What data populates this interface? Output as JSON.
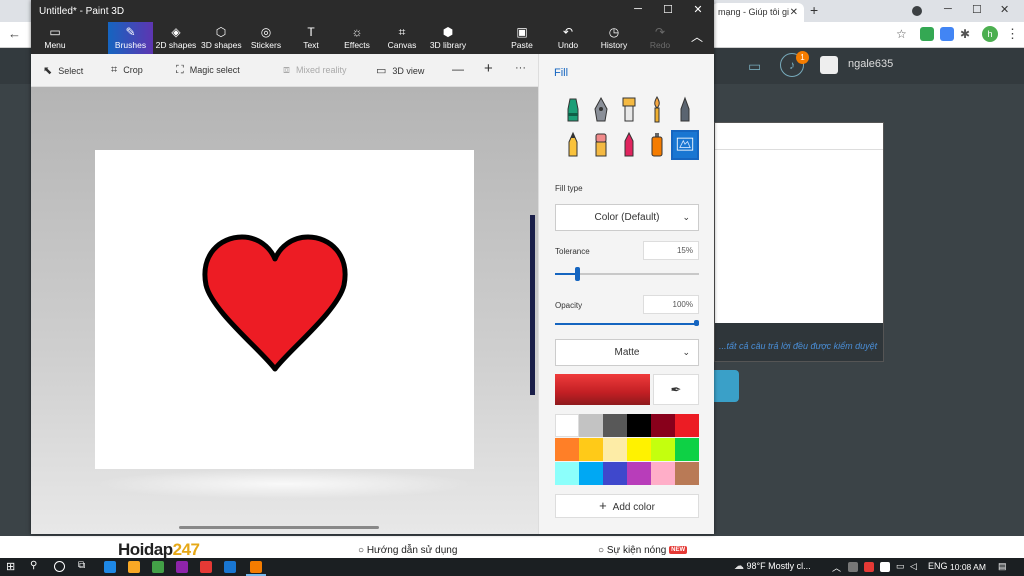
{
  "browser": {
    "tab_title": "mạng - Giúp tôi gi",
    "tab_close": "✕",
    "new_tab": "+",
    "min": "─",
    "max": "☐",
    "close": "✕",
    "avatar_letter": "h",
    "back": "←"
  },
  "site": {
    "user_name": "ngale635",
    "notification_count": "1",
    "note": "...tất cả câu trả lời đều được kiểm duyệt",
    "logo_prefix": "Hoidap",
    "logo_suffix": "247",
    "link_guide": "○ Hướng dẫn sử dụng",
    "link_events": "○ Sự kiện nóng",
    "new_badge": "NEW"
  },
  "paint3d": {
    "title": "Untitled* - Paint 3D",
    "window_buttons": {
      "minimize": "─",
      "maximize": "☐",
      "close": "✕"
    },
    "ribbon": {
      "menu": "Menu",
      "brushes": "Brushes",
      "shapes2d": "2D shapes",
      "shapes3d": "3D shapes",
      "stickers": "Stickers",
      "text": "Text",
      "effects": "Effects",
      "canvas": "Canvas",
      "library3d": "3D library",
      "paste": "Paste",
      "undo": "Undo",
      "history": "History",
      "redo": "Redo",
      "collapse": "︿"
    },
    "toolbar": {
      "select": "Select",
      "crop": "Crop",
      "magic_select": "Magic select",
      "mixed_reality": "Mixed reality",
      "view3d": "3D view",
      "zoom_out": "—",
      "zoom_in": "+",
      "more": "···"
    },
    "side_panel": {
      "title": "Fill",
      "fill_type_label": "Fill type",
      "fill_type_value": "Color (Default)",
      "tolerance_label": "Tolerance",
      "tolerance_value": "15%",
      "tolerance_fraction": 0.15,
      "opacity_label": "Opacity",
      "opacity_value": "100%",
      "opacity_fraction": 1.0,
      "finish_value": "Matte",
      "add_color": "Add color",
      "current_color": "#e8262d",
      "palette": [
        "#ffffff",
        "#c3c3c3",
        "#585858",
        "#000000",
        "#88001b",
        "#ec1c24",
        "#ff7f27",
        "#ffca18",
        "#fdeca6",
        "#fff200",
        "#c4ff0e",
        "#0ed145",
        "#8cfffb",
        "#00a8f3",
        "#3f48cc",
        "#b83dba",
        "#ffaec8",
        "#b97a56"
      ],
      "brushes": [
        "marker",
        "calligraphy-pen",
        "oil-brush",
        "watercolor",
        "pixel-pen",
        "pencil",
        "eraser",
        "crayon",
        "spray-can",
        "fill"
      ]
    },
    "canvas": {
      "shape": "heart",
      "fill_color": "#ed1c24",
      "outline_color": "#000000"
    }
  },
  "taskbar": {
    "weather_temp": "98°F",
    "weather_desc": "Mostly cl...",
    "language": "ENG",
    "time": "10:08 AM"
  }
}
